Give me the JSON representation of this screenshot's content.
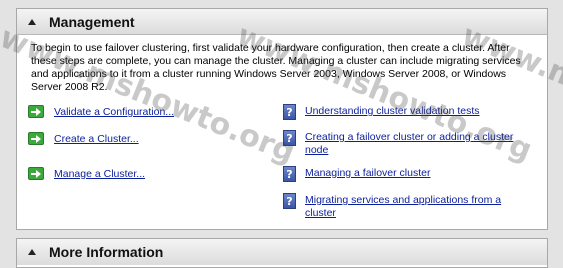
{
  "management": {
    "title": "Management",
    "intro": "To begin to use failover clustering, first validate your hardware configuration, then create a cluster.  After these steps are complete, you can manage the cluster.  Managing a cluster can include migrating services and applications to it from a cluster running Windows Server 2003, Windows Server 2008, or Windows Server 2008 R2.",
    "actions": [
      {
        "label": "Validate a Configuration...",
        "icon": "green-arrow-icon"
      },
      {
        "label": "Create a Cluster...",
        "icon": "green-arrow-icon"
      },
      {
        "label": "Manage a Cluster...",
        "icon": "green-arrow-icon"
      }
    ],
    "help": [
      {
        "label": "Understanding cluster validation tests",
        "icon": "help-icon"
      },
      {
        "label": "Creating a failover cluster or adding a cluster node",
        "icon": "help-icon"
      },
      {
        "label": "Managing a failover cluster",
        "icon": "help-icon"
      },
      {
        "label": "Migrating services and applications from a cluster",
        "icon": "help-icon"
      }
    ]
  },
  "more_info": {
    "title": "More Information"
  },
  "watermark": "www.mshowto.org",
  "colors": {
    "link": "#0b1f9c",
    "action_icon": "#3ba93b",
    "help_icon": "#3b56a8"
  }
}
